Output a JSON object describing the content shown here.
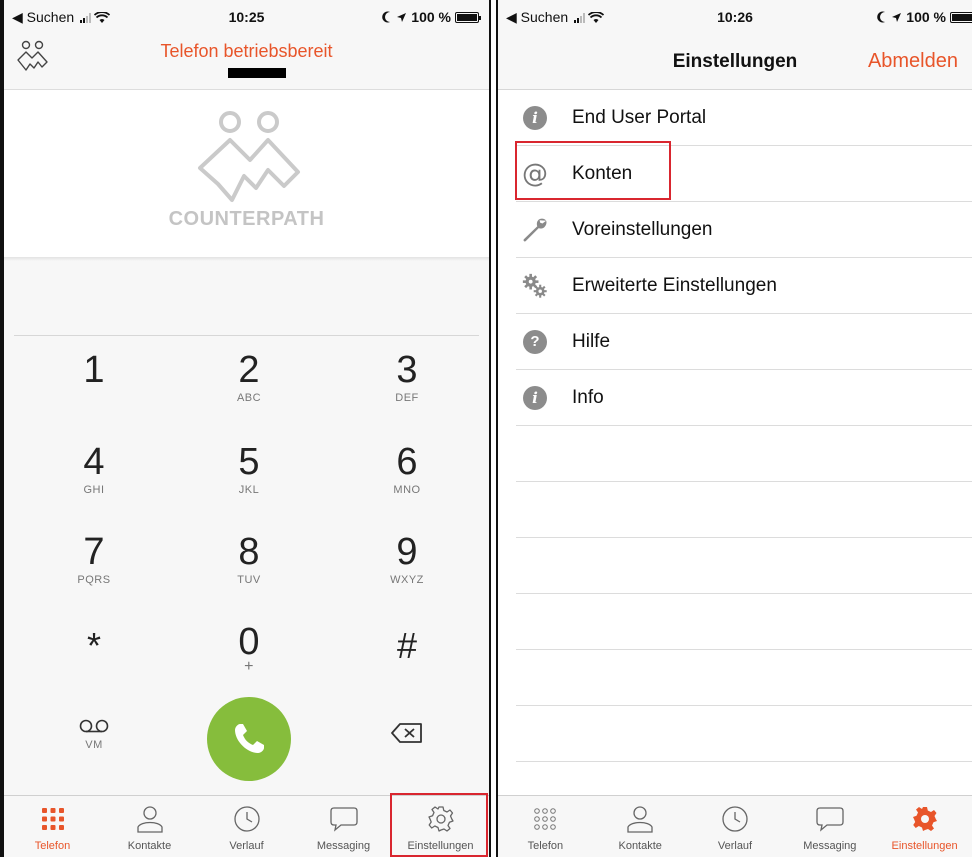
{
  "left": {
    "status_bar": {
      "back_label": "◀ Suchen",
      "time": "10:25",
      "battery": "100 %"
    },
    "header": {
      "title": "Telefon betriebsbereit"
    },
    "logo": {
      "text": "COUNTERPATH"
    },
    "keypad": [
      {
        "digit": "1",
        "letters": ""
      },
      {
        "digit": "2",
        "letters": "ABC"
      },
      {
        "digit": "3",
        "letters": "DEF"
      },
      {
        "digit": "4",
        "letters": "GHI"
      },
      {
        "digit": "5",
        "letters": "JKL"
      },
      {
        "digit": "6",
        "letters": "MNO"
      },
      {
        "digit": "7",
        "letters": "PQRS"
      },
      {
        "digit": "8",
        "letters": "TUV"
      },
      {
        "digit": "9",
        "letters": "WXYZ"
      },
      {
        "digit": "*",
        "letters": ""
      },
      {
        "digit": "0",
        "letters": "+"
      },
      {
        "digit": "#",
        "letters": ""
      }
    ],
    "voicemail_label": "VM",
    "tabs": [
      {
        "label": "Telefon",
        "icon": "dialpad-icon",
        "active": true
      },
      {
        "label": "Kontakte",
        "icon": "contact-icon",
        "active": false
      },
      {
        "label": "Verlauf",
        "icon": "clock-icon",
        "active": false
      },
      {
        "label": "Messaging",
        "icon": "chat-bubble-icon",
        "active": false
      },
      {
        "label": "Einstellungen",
        "icon": "gear-icon",
        "active": false
      }
    ]
  },
  "right": {
    "status_bar": {
      "back_label": "◀ Suchen",
      "time": "10:26",
      "battery": "100 %"
    },
    "header": {
      "title": "Einstellungen",
      "logout_label": "Abmelden"
    },
    "settings_items": [
      {
        "label": "End User Portal",
        "icon": "info-icon"
      },
      {
        "label": "Konten",
        "icon": "at-sign-icon"
      },
      {
        "label": "Voreinstellungen",
        "icon": "wrench-icon"
      },
      {
        "label": "Erweiterte Einstellungen",
        "icon": "gears-icon"
      },
      {
        "label": "Hilfe",
        "icon": "help-icon"
      },
      {
        "label": "Info",
        "icon": "info-icon"
      }
    ],
    "tabs": [
      {
        "label": "Telefon",
        "icon": "dialpad-icon",
        "active": false
      },
      {
        "label": "Kontakte",
        "icon": "contact-icon",
        "active": false
      },
      {
        "label": "Verlauf",
        "icon": "clock-icon",
        "active": false
      },
      {
        "label": "Messaging",
        "icon": "chat-bubble-icon",
        "active": false
      },
      {
        "label": "Einstellungen",
        "icon": "gear-icon",
        "active": true
      }
    ]
  },
  "colors": {
    "accent": "#e8552a",
    "call_green": "#86bd3c",
    "highlight": "#d9262f"
  }
}
